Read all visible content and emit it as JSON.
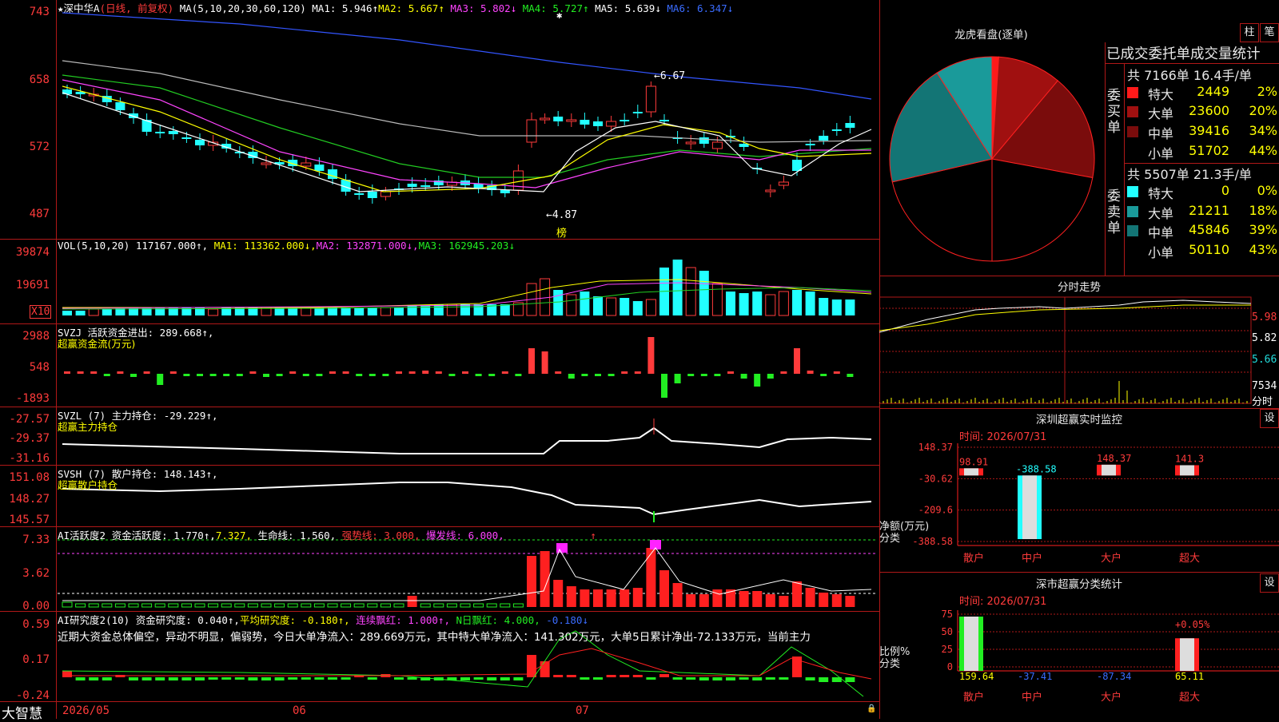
{
  "main_chart": {
    "star": "★",
    "stock_name": "深中华A",
    "period_note": "(日线, 前复权)",
    "ma_params": "MA(5,10,20,30,60,120)",
    "ma1": "MA1: 5.946↑",
    "ma2": "MA2: 5.667↑",
    "ma3": "MA3: 5.802↓",
    "ma4": "MA4: 5.727↑",
    "ma5": "MA5: 5.639↓",
    "ma6": "MA6: 6.347↓",
    "y_labels": [
      "743",
      "658",
      "572",
      "487"
    ],
    "high_annotation": "←6.67",
    "low_annotation": "←4.87",
    "bang_label": "榜",
    "marker": "✱"
  },
  "vol_panel": {
    "header": "VOL(5,10,20) 117167.000↑,",
    "ma1": "MA1: 113362.000↓,",
    "ma2": "MA2: 132871.000↓,",
    "ma3": "MA3: 162945.203↓",
    "y_labels": [
      "39874",
      "19691"
    ],
    "unit": "X10"
  },
  "svzj_panel": {
    "header": "SVZJ  活跃资金进出: 289.668↑,",
    "subtitle": "超赢资金流(万元)",
    "y_labels": [
      "2988",
      "548",
      "-1893"
    ]
  },
  "svzl_panel": {
    "header": "SVZL (7) 主力持仓: -29.229↑,",
    "subtitle": "超赢主力持仓",
    "y_labels": [
      "-27.57",
      "-29.37",
      "-31.16"
    ]
  },
  "svsh_panel": {
    "header": "SVSH (7) 散户持仓: 148.143↑,",
    "subtitle": "超赢散户持仓",
    "y_labels": [
      "151.08",
      "148.27",
      "145.57"
    ]
  },
  "ai_active_panel": {
    "header": "AI活跃度2 资金活跃度: 1.770↑,",
    "v2": "7.327,",
    "life_line": "生命线: 1.560,",
    "strong_line": "强势线: 3.000,",
    "burst_line": "爆发线: 6.000,",
    "arrow": "↑",
    "y_labels": [
      "7.33",
      "3.62",
      "0.00"
    ]
  },
  "ai_research_panel": {
    "header": "AI研究度2(10) 资金研究度: 0.040↑,",
    "avg": "平均研究度: -0.180↑,",
    "red_streak": "连续飘红: 1.000↑,",
    "n_red": "N日飘红: 4.000,",
    "last": "-0.180↓",
    "commentary": "近期大资金总体偏空，异动不明显，偏弱势，今日大单净流入：289.669万元，其中特大单净流入：141.302万元，大单5日累计净出-72.133万元，当前主力",
    "y_labels": [
      "0.59",
      "0.17",
      "-0.24"
    ]
  },
  "bottom_bar": {
    "brand": "大智慧",
    "date_labels": [
      "2026/05",
      "06",
      "07"
    ],
    "lock": "🔒"
  },
  "dragon_tiger": {
    "title": "龙虎看盘(逐单)",
    "btn_bar": "柱",
    "btn_pen": "笔",
    "header": "已成交委托单成交量统计",
    "buy_side": "委买单",
    "sell_side": "委卖单",
    "buy_summary": "共 7166单 16.4手/单",
    "sell_summary": "共 5507单 21.3手/单",
    "buy_rows": [
      {
        "name": "特大",
        "value": "2449",
        "pct": "2%",
        "color": "#ff1a1a"
      },
      {
        "name": "大单",
        "value": "23600",
        "pct": "20%",
        "color": "#a01010"
      },
      {
        "name": "中单",
        "value": "39416",
        "pct": "34%",
        "color": "#7a0c0c"
      },
      {
        "name": "小单",
        "value": "51702",
        "pct": "44%",
        "color": "#000000"
      }
    ],
    "sell_rows": [
      {
        "name": "特大",
        "value": "0",
        "pct": "0%",
        "color": "#22ffff"
      },
      {
        "name": "大单",
        "value": "21211",
        "pct": "18%",
        "color": "#1a9a9a"
      },
      {
        "name": "中单",
        "value": "45846",
        "pct": "39%",
        "color": "#137575"
      },
      {
        "name": "小单",
        "value": "50110",
        "pct": "43%",
        "color": "#000000"
      }
    ]
  },
  "intraday": {
    "title": "分时走势",
    "y_labels": [
      "5.98",
      "5.82",
      "5.66"
    ],
    "vol_label": "7534",
    "vol_unit": "分时"
  },
  "sz_monitor": {
    "title": "深圳超赢实时监控",
    "btn": "设",
    "time": "时间: 2026/07/31",
    "y_labels": [
      "148.37",
      "-30.62",
      "-209.6",
      "-388.58"
    ],
    "y_axis_title": "净额(万元)",
    "x_axis_title": "分类",
    "bars": [
      {
        "label": "散户",
        "value": 98.91,
        "text": "98.91"
      },
      {
        "label": "中户",
        "value": -388.58,
        "text": "-388.58"
      },
      {
        "label": "大户",
        "value": 148.37,
        "text": "148.37"
      },
      {
        "label": "超大",
        "value": 141.3,
        "text": "141.3"
      }
    ]
  },
  "sz_classify": {
    "title": "深市超赢分类统计",
    "btn": "设",
    "time": "时间: 2026/07/31",
    "y_labels": [
      "75",
      "50",
      "25",
      "0"
    ],
    "y_axis_title": "比例%",
    "x_axis_title": "分类",
    "bars": [
      {
        "label": "散户",
        "value": 100,
        "text": "159.64"
      },
      {
        "label": "中户",
        "value": 0,
        "text": "-37.41"
      },
      {
        "label": "大户",
        "value": 0,
        "text": "-87.34"
      },
      {
        "label": "超大",
        "value": 60,
        "text": "65.11"
      }
    ],
    "annotation": "+0.05%"
  }
}
